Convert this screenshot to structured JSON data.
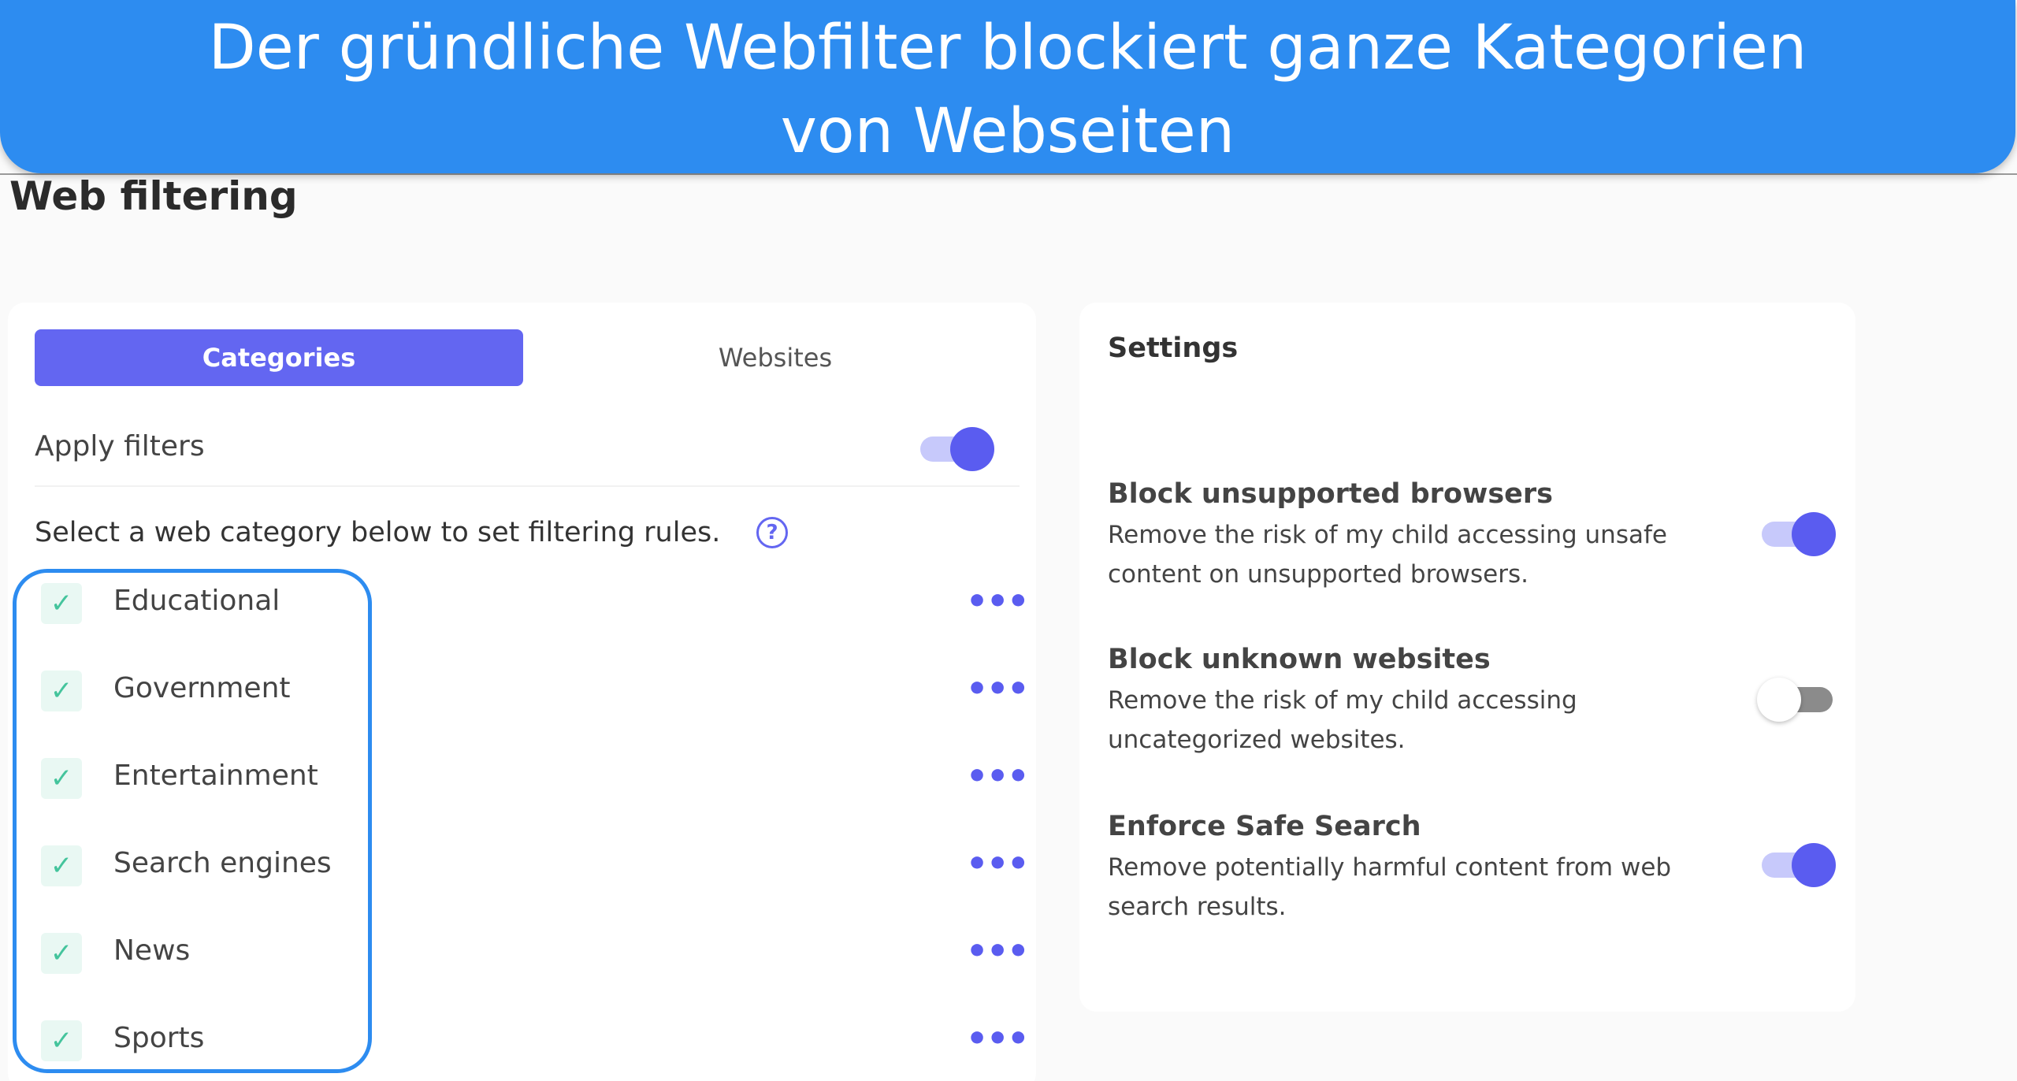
{
  "banner": {
    "line1": "Der gründliche Webfilter blockiert ganze Kategorien",
    "line2": "von Webseiten"
  },
  "page": {
    "title": "Web filtering"
  },
  "tabs": {
    "categories": "Categories",
    "websites": "Websites",
    "active": "Categories"
  },
  "filters": {
    "apply_label": "Apply filters",
    "apply_on": true,
    "instructions": "Select a web category below to set filtering rules.",
    "help_icon": "?"
  },
  "categories": [
    {
      "label": "Educational",
      "checked": true,
      "check_icon": "✓",
      "more": "•••"
    },
    {
      "label": "Government",
      "checked": true,
      "check_icon": "✓",
      "more": "•••"
    },
    {
      "label": "Entertainment",
      "checked": true,
      "check_icon": "✓",
      "more": "•••"
    },
    {
      "label": "Search engines",
      "checked": true,
      "check_icon": "✓",
      "more": "•••"
    },
    {
      "label": "News",
      "checked": true,
      "check_icon": "✓",
      "more": "•••"
    },
    {
      "label": "Sports",
      "checked": true,
      "check_icon": "✓",
      "more": "•••"
    }
  ],
  "settings": {
    "title": "Settings",
    "items": [
      {
        "title": "Block unsupported browsers",
        "desc": "Remove the risk of my child accessing unsafe content on unsupported browsers.",
        "on": true
      },
      {
        "title": "Block unknown websites",
        "desc": "Remove the risk of my child accessing uncategorized websites.",
        "on": false
      },
      {
        "title": "Enforce Safe Search",
        "desc": "Remove potentially harmful content from web search results.",
        "on": true
      }
    ]
  },
  "colors": {
    "banner": "#2d8cf0",
    "accent": "#6366f1",
    "check": "#44c49c",
    "highlight": "#2d8cf0"
  }
}
